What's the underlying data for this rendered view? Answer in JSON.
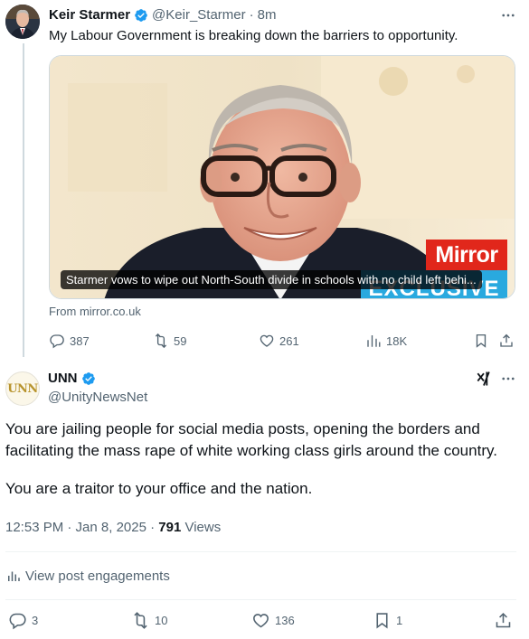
{
  "parent_tweet": {
    "author_name": "Keir Starmer",
    "handle": "@Keir_Starmer",
    "time": "8m",
    "text": "My Labour Government is breaking down the barriers to opportunity.",
    "card": {
      "headline": "Starmer vows to wipe out North-South divide in schools with no child left behi...",
      "brand_label": "Mirror",
      "badge_label": "EXCLUSIVE",
      "source": "From mirror.co.uk"
    },
    "stats": {
      "replies": "387",
      "reposts": "59",
      "likes": "261",
      "views": "18K"
    }
  },
  "main_tweet": {
    "author_name": "UNN",
    "avatar_text": "UNN",
    "handle": "@UnityNewsNet",
    "text_paragraph_1": "You are jailing people for social media posts, opening the borders and facilitating the mass rape of white working class girls around the country.",
    "text_paragraph_2": "You are a traitor to your office and the nation.",
    "timestamp": "12:53 PM · Jan 8, 2025 · ",
    "views_count": "791",
    "views_label": " Views",
    "engagements_label": "View post engagements",
    "stats": {
      "replies": "3",
      "reposts": "10",
      "likes": "136",
      "bookmarks": "1"
    }
  },
  "colors": {
    "text_primary": "#0f1419",
    "text_secondary": "#536471",
    "verified_blue": "#1d9bf0",
    "divider": "#eff3f4",
    "mirror_red": "#e1271b",
    "exclusive_blue": "#29a9df"
  },
  "icons": [
    "verified-badge-icon",
    "more-icon",
    "reply-icon",
    "repost-icon",
    "like-icon",
    "views-icon",
    "bookmark-icon",
    "share-icon",
    "grok-icon",
    "analytics-icon"
  ]
}
